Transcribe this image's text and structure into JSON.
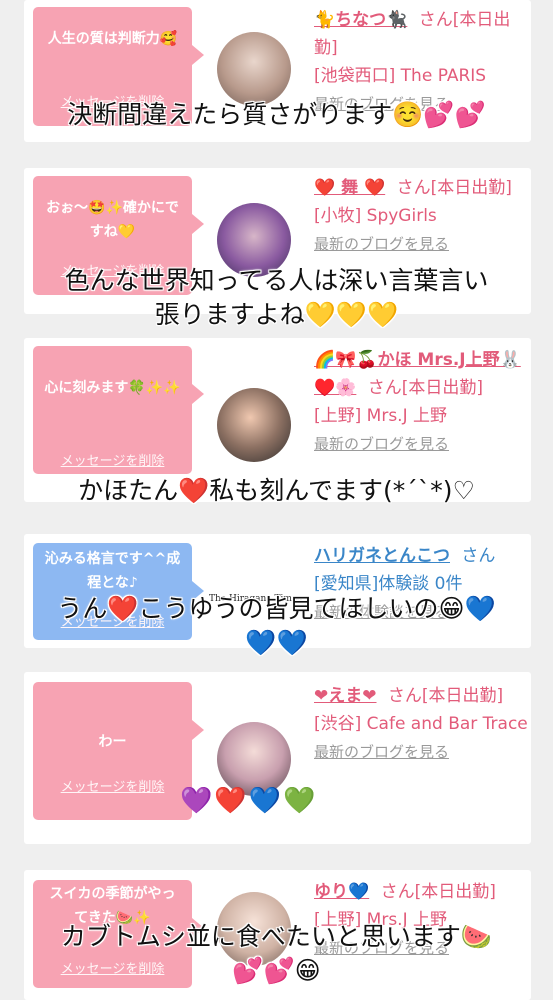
{
  "cards": [
    {
      "message": "人生の質は判断力🥰",
      "delete_label": "メッセージを削除",
      "name": "🐈ちなつ🐈‍⬛",
      "suffix": "さん[本日出勤]",
      "store": "[池袋西口] The PARIS",
      "link": "最新のブログを見る",
      "overlay": "決断間違えたら質さがります☺️💕💕"
    },
    {
      "message": "おぉ〜🤩✨確かにですね💛",
      "delete_label": "メッセージを削除",
      "name": "❤️ 舞 ❤️",
      "suffix": "さん[本日出勤]",
      "store": "[小牧] SpyGirls",
      "link": "最新のブログを見る",
      "overlay_line1": "色んな世界知ってる人は深い言葉言い",
      "overlay_line2": "張りますよね💛💛💛"
    },
    {
      "message": "心に刻みます🍀✨✨",
      "delete_label": "メッセージを削除",
      "name": "🌈🎀🍒かほ Mrs.J上野🐰♥️🌸",
      "suffix": "さん[本日出勤]",
      "store": "[上野] Mrs.J 上野",
      "link": "最新のブログを見る",
      "overlay": "かほたん❤️私も刻んでます(*´`*)♡"
    },
    {
      "message": "沁みる格言です^^成程とな♪",
      "delete_label": "メッセージを削除",
      "name": "ハリガネとんこつ",
      "suffix": "さん",
      "store": "[愛知県]体験談 0件",
      "link": "最新の体験談を見る",
      "overlay_line1": "うん❤️こうゆうの皆見てほしいの😁💙",
      "overlay_line2": "💙💙"
    },
    {
      "message": "わー",
      "delete_label": "メッセージを削除",
      "name": "❤えま❤",
      "suffix": "さん[本日出勤]",
      "store": "[渋谷] Cafe and Bar Trace",
      "link": "最新のブログを見る",
      "overlay": "💜❤️💙💚"
    },
    {
      "message": "スイカの季節がやってきた🍉✨",
      "delete_label": "メッセージを削除",
      "name": "ゆり💙",
      "suffix": "さん[本日出勤]",
      "store": "[上野] Mrs.J 上野",
      "link": "最新のブログを見る",
      "overlay_line1": "カブトムシ並に食べたいと思います🍉",
      "overlay_line2": "💕💕😁"
    }
  ],
  "watermark": "The Hiragana Times",
  "colors": {
    "pink_bubble": "#f7a3b3",
    "blue_bubble": "#8db8f2",
    "pink_text": "#e25b7a",
    "blue_text": "#3a86c8"
  }
}
